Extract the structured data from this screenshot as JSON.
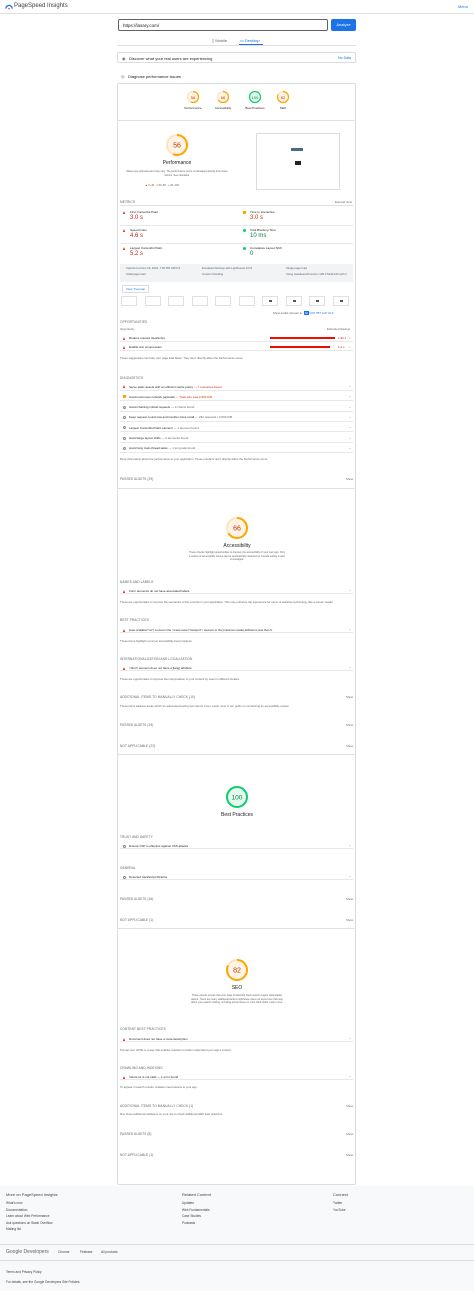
{
  "header": {
    "title": "PageSpeed Insights",
    "menu": "Menu"
  },
  "search": {
    "url": "https://lasary.com/",
    "analyze": "Analyze"
  },
  "tabs": {
    "mobile": "Mobile",
    "desktop": "Desktop"
  },
  "crux": {
    "label": "Discover what your real users are experiencing",
    "no_data": "No Data"
  },
  "diagnose": {
    "label": "Diagnose performance issues"
  },
  "scores": [
    {
      "value": "56",
      "label": "Performance",
      "color": "#ffa400"
    },
    {
      "value": "66",
      "label": "Accessibility",
      "color": "#ffa400"
    },
    {
      "value": "100",
      "label": "Best Practices",
      "color": "#0cce6b"
    },
    {
      "value": "82",
      "label": "SEO",
      "color": "#ffa400"
    }
  ],
  "perf": {
    "score": "56",
    "title": "Performance",
    "note": "Values are estimated and may vary. The performance score is calculated directly from these metrics. See calculator.",
    "legend": [
      "0–49",
      "50–89",
      "90–100"
    ]
  },
  "metrics": {
    "heading": "METRICS",
    "expand": "Expand view",
    "items": [
      {
        "label": "First Contentful Paint",
        "value": "3.0 s",
        "cls": "red"
      },
      {
        "label": "Time to Interactive",
        "value": "3.0 s",
        "cls": "orange"
      },
      {
        "label": "Speed Index",
        "value": "4.6 s",
        "cls": "red"
      },
      {
        "label": "Total Blocking Time",
        "value": "10 ms",
        "cls": "green"
      },
      {
        "label": "Largest Contentful Paint",
        "value": "5.2 s",
        "cls": "red"
      },
      {
        "label": "Cumulative Layout Shift",
        "value": "0",
        "cls": "green"
      }
    ]
  },
  "runinfo": [
    "Captured at Nov 16, 2022, 7:30 PM GMT+5",
    "Emulated Desktop with Lighthouse 9.6.8",
    "Single page load",
    "Initial page load",
    "Custom throttling",
    "Using HeadlessChromium 106.0.5249.103 with lr"
  ],
  "treemap": "View Treemap",
  "filter": {
    "label": "Show audits relevant to:",
    "all": "All",
    "fcp": "FCP",
    "tbt": "TBT",
    "lcp": "LCP",
    "cls": "CLS"
  },
  "opportunities": {
    "heading": "OPPORTUNITIES",
    "col1": "Opportunity",
    "col2": "Estimated Savings",
    "items": [
      {
        "label": "Reduce unused JavaScript",
        "value": "1.92 s"
      },
      {
        "label": "Enable text compression",
        "value": "1.4 s"
      }
    ],
    "note": "These suggestions can help your page load faster. They don't directly affect the Performance score."
  },
  "diagnostics": {
    "heading": "DIAGNOSTICS",
    "items": [
      {
        "label": "Serve static assets with an efficient cache policy — 7 resources found",
        "type": "red"
      },
      {
        "label": "Avoid enormous network payloads — Total size was 2,962 KiB",
        "type": "orange"
      },
      {
        "label": "Avoid chaining critical requests — 3 chains found",
        "type": "info"
      },
      {
        "label": "Keep request counts low and transfer sizes small — 232 requests • 2,963 KiB",
        "type": "info"
      },
      {
        "label": "Largest Contentful Paint element — 1 element found",
        "type": "info"
      },
      {
        "label": "Avoid large layout shifts — 2 elements found",
        "type": "info"
      },
      {
        "label": "Avoid long main-thread tasks — 1 long task found",
        "type": "info"
      }
    ],
    "note": "More information about the performance of your application. These numbers don't directly affect the Performance score."
  },
  "passed": "PASSED AUDITS (29)",
  "show": "Show",
  "a11y": {
    "score": "66",
    "title": "Accessibility",
    "desc": "These checks highlight opportunities to improve the accessibility of your web app. Only a subset of accessibility issues can be automatically detected so manual testing is also encouraged.",
    "names_heading": "NAMES AND LABELS",
    "names_item": "Form elements do not have associated labels",
    "names_note": "These are opportunities to improve the semantics of the controls in your application. This may enhance the experience for users of assistive technology, like a screen reader.",
    "bp_heading": "BEST PRACTICES",
    "bp_item": "[user-scalable=\"no\"] is used in the <meta name=\"viewport\"> element or the [maximum-scale] attribute is less than 5.",
    "bp_note": "These items highlight common accessibility best practices.",
    "intl_heading": "INTERNATIONALIZATION AND LOCALIZATION",
    "intl_item": "<html> element does not have a [lang] attribute",
    "intl_note": "These are opportunities to improve the interpretation of your content by users in different locales.",
    "manual_heading": "ADDITIONAL ITEMS TO MANUALLY CHECK (10)",
    "manual_note": "These items address areas which an automated testing tool cannot cover. Learn more in our guide on conducting an accessibility review.",
    "passed": "PASSED AUDITS (19)",
    "na": "NOT APPLICABLE (22)"
  },
  "bp": {
    "score": "100",
    "title": "Best Practices",
    "trust_heading": "TRUST AND SAFETY",
    "trust_item": "Ensure CSP is effective against XSS attacks",
    "general_heading": "GENERAL",
    "general_item": "Detected JavaScript libraries",
    "passed": "PASSED AUDITS (16)",
    "na": "NOT APPLICABLE (1)"
  },
  "seo": {
    "score": "82",
    "title": "SEO",
    "desc": "These checks ensure that your page is following basic search engine optimization advice. There are many additional factors Lighthouse does not score here that may affect your search ranking, including performance on Core Web Vitals. Learn more.",
    "content_heading": "CONTENT BEST PRACTICES",
    "content_item": "Document does not have a meta description",
    "content_note": "Format your HTML in a way that enables crawlers to better understand your app's content.",
    "crawl_heading": "CRAWLING AND INDEXING",
    "crawl_item": "robots.txt is not valid — 1 error found",
    "crawl_note": "To appear in search results, crawlers need access to your app.",
    "manual_heading": "ADDITIONAL ITEMS TO MANUALLY CHECK (1)",
    "manual_note": "Run these additional validators on your site to check additional SEO best practices.",
    "passed": "PASSED AUDITS (8)",
    "na": "NOT APPLICABLE (1)"
  },
  "footer": {
    "col1_title": "More on PageSpeed Insights",
    "col1": [
      "What's new",
      "Documentation",
      "Learn about Web Performance",
      "Ask questions on Stack Overflow",
      "Mailing list"
    ],
    "col2_title": "Related Content",
    "col2": [
      "Updates",
      "Web Fundamentals",
      "Case Studies",
      "Podcasts"
    ],
    "col3_title": "Connect",
    "col3": [
      "Twitter",
      "YouTube"
    ],
    "brand": "Google Developers",
    "links": [
      "Chrome",
      "Firebase",
      "All products"
    ],
    "terms": "Terms and Privacy Policy",
    "details": "For details, see the Google Developers Site Policies."
  }
}
